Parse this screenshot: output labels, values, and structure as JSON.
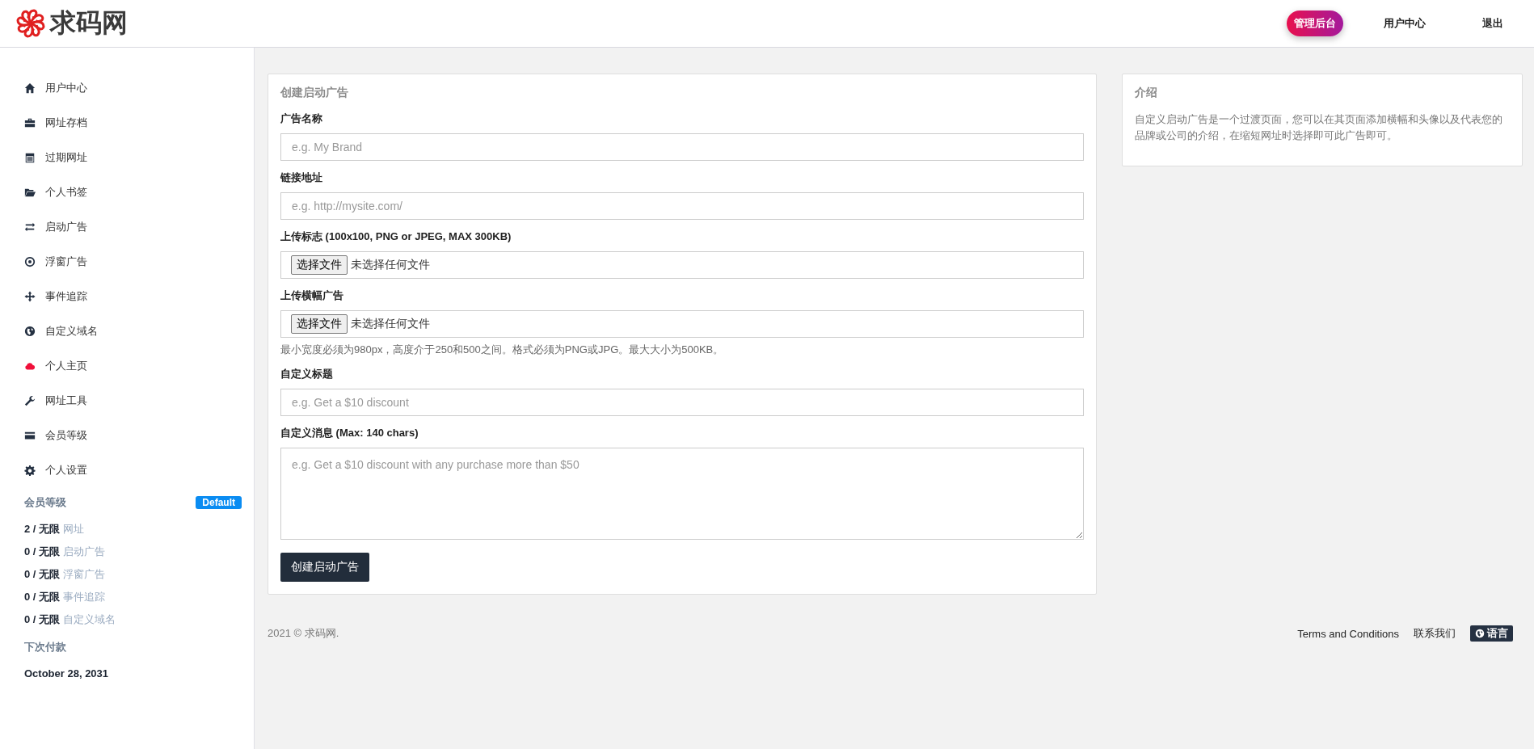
{
  "header": {
    "logo_text": "求码网",
    "nav": [
      {
        "label": "管理后台",
        "kind": "pill"
      },
      {
        "label": "用户中心",
        "kind": "link"
      },
      {
        "label": "退出",
        "kind": "link"
      }
    ]
  },
  "sidebar": {
    "items": [
      {
        "label": "用户中心"
      },
      {
        "label": "网址存档"
      },
      {
        "label": "过期网址"
      },
      {
        "label": "个人书签"
      },
      {
        "label": "启动广告"
      },
      {
        "label": "浮窗广告"
      },
      {
        "label": "事件追踪"
      },
      {
        "label": "自定义域名"
      },
      {
        "label": "个人主页"
      },
      {
        "label": "网址工具"
      },
      {
        "label": "会员等级"
      },
      {
        "label": "个人设置"
      }
    ],
    "plan": {
      "title": "会员等级",
      "badge": "Default",
      "usage": [
        {
          "count": "2 / 无限",
          "name": "网址"
        },
        {
          "count": "0 / 无限",
          "name": "启动广告"
        },
        {
          "count": "0 / 无限",
          "name": "浮窗广告"
        },
        {
          "count": "0 / 无限",
          "name": "事件追踪"
        },
        {
          "count": "0 / 无限",
          "name": "自定义域名"
        }
      ],
      "next_payment_title": "下次付款",
      "next_payment_date": "October 28, 2031"
    }
  },
  "form": {
    "title": "创建启动广告",
    "fields": [
      {
        "kind": "text",
        "label": "广告名称",
        "placeholder": "e.g. My Brand"
      },
      {
        "kind": "text",
        "label": "链接地址",
        "placeholder": "e.g. http://mysite.com/"
      },
      {
        "kind": "file",
        "label": "上传标志 (100x100, PNG or JPEG, MAX 300KB)",
        "button": "选择文件",
        "status": "未选择任何文件"
      },
      {
        "kind": "file",
        "label": "上传横幅广告",
        "button": "选择文件",
        "status": "未选择任何文件",
        "help": "最小宽度必须为980px，高度介于250和500之间。格式必须为PNG或JPG。最大大小为500KB。"
      },
      {
        "kind": "text",
        "label": "自定义标题",
        "placeholder": "e.g. Get a $10 discount"
      },
      {
        "kind": "textarea",
        "label": "自定义消息 (Max: 140 chars)",
        "placeholder": "e.g. Get a $10 discount with any purchase more than $50"
      }
    ],
    "submit": "创建启动广告"
  },
  "intro": {
    "title": "介绍",
    "text": "自定义启动广告是一个过渡页面，您可以在其页面添加横幅和头像以及代表您的品牌或公司的介绍，在缩短网址时选择即可此广告即可。"
  },
  "footer": {
    "copyright": "2021 © 求码网.",
    "links": [
      "Terms and Conditions",
      "联系我们"
    ],
    "language": "语言"
  }
}
